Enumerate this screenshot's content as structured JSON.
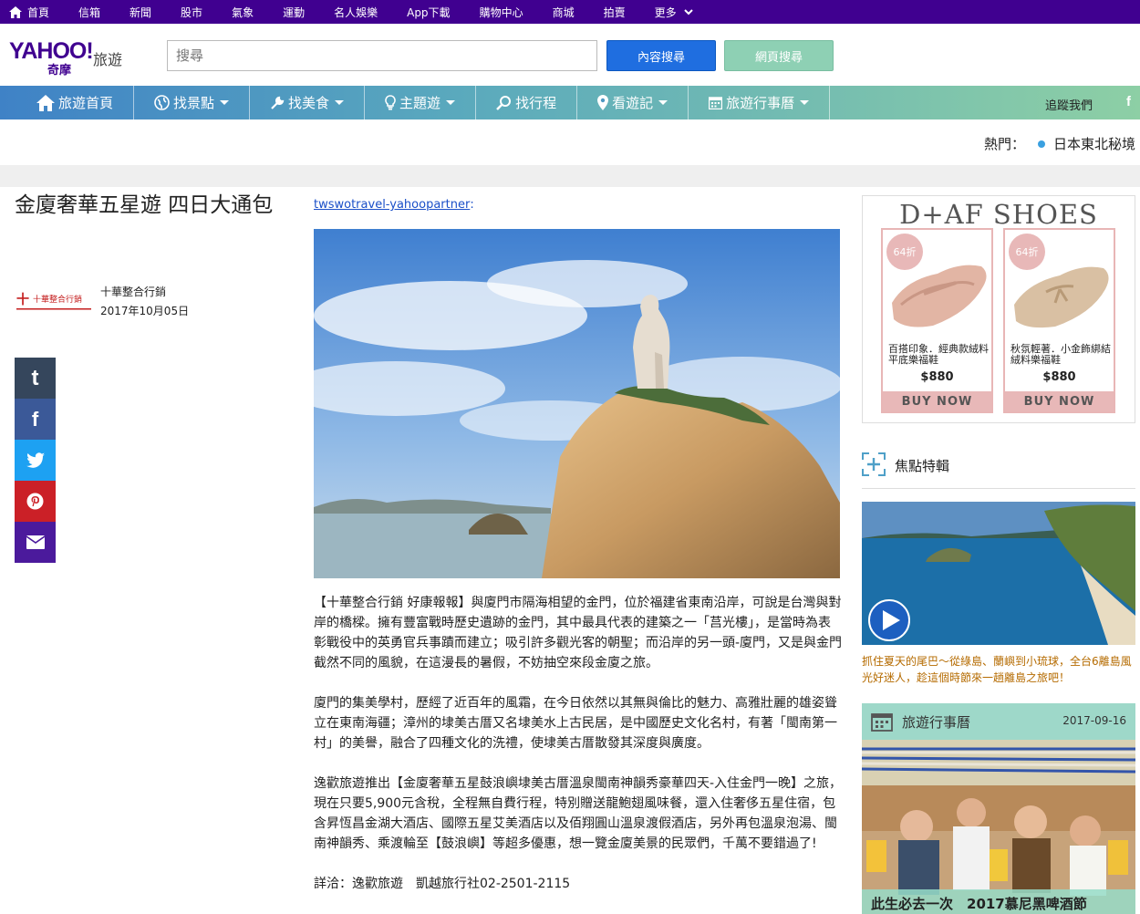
{
  "topbar": {
    "items": [
      "首頁",
      "信箱",
      "新聞",
      "股市",
      "氣象",
      "運動",
      "名人娛樂",
      "App下載",
      "購物中心",
      "商城",
      "拍賣",
      "更多"
    ]
  },
  "header": {
    "logo_text": "YAHOO!",
    "logo_sub": "奇摩",
    "section": "旅遊",
    "search_placeholder": "搜尋",
    "content_search": "內容搜尋",
    "web_search": "網頁搜尋"
  },
  "nav": {
    "items": [
      "旅遊首頁",
      "找景點",
      "找美食",
      "主題遊",
      "找行程",
      "看遊記",
      "旅遊行事曆"
    ],
    "follow": "追蹤我們",
    "fb": "f"
  },
  "hot": {
    "label": "熱門：",
    "link": "日本東北秘境"
  },
  "article": {
    "title": "金廈奢華五星遊 四日大通包",
    "author": "十華整合行銷",
    "date": "2017年10月05日",
    "logo_alt": "十華整合行銷",
    "source": "twswotravel-yahoopartner",
    "source_colon": ":",
    "paragraphs": [
      "【十華整合行銷 好康報報】與廈門市隔海相望的金門，位於福建省東南沿岸，可說是台灣與對岸的橋樑。擁有豐富戰時歷史遺跡的金門，其中最具代表的建築之一「莒光樓」，是當時為表彰戰役中的英勇官兵事蹟而建立；吸引許多觀光客的朝聖；而沿岸的另一頭-廈門，又是與金門截然不同的風貌，在這漫長的暑假，不妨抽空來段金廈之旅。",
      "廈門的集美學村，歷經了近百年的風霜，在今日依然以其無與倫比的魅力、高雅壯麗的雄姿聳立在東南海疆；漳州的埭美古厝又名埭美水上古民居，是中國歷史文化名村，有著「閩南第一村」的美譽，融合了四種文化的洗禮，使埭美古厝散發其深度與廣度。",
      "逸歡旅遊推出【金廈奢華五星鼓浪嶼埭美古厝溫泉閩南神韻秀豪華四天-入住金門一晚】之旅，現在只要5,900元含稅，全程無自費行程，特別贈送龍鮑翅風味餐，還入住奢侈五星住宿，包含昇恆昌金湖大酒店、國際五星艾美酒店以及佰翔圓山溫泉渡假酒店，另外再包溫泉泡湯、閩南神韻秀、乘渡輪至【鼓浪嶼】等超多優惠，想一覽金廈美景的民眾們，千萬不要錯過了!",
      "詳洽：逸歡旅遊　凱越旅行社02-2501-2115"
    ]
  },
  "ad": {
    "brand": "D+AF SHOES",
    "products": [
      {
        "discount": "64折",
        "name": "百搭印象．經典款絨料平底樂福鞋",
        "price": "$880",
        "cta": "BUY NOW"
      },
      {
        "discount": "64折",
        "name": "秋氛輕著．小金飾綁結絨料樂福鞋",
        "price": "$880",
        "cta": "BUY NOW"
      }
    ]
  },
  "focus": {
    "title": "焦點特輯",
    "caption": "抓住夏天的尾巴～從綠島、蘭嶼到小琉球，全台6離島風光好迷人，趁這個時節來一趟離島之旅吧！"
  },
  "calendar": {
    "title": "旅遊行事曆",
    "date": "2017-09-16",
    "caption": "此生必去一次　2017慕尼黑啤酒節"
  },
  "colors": {
    "topbar": "#400090",
    "nav_start": "#3f82c6",
    "nav_end": "#8dcfa5",
    "primary_button": "#1f6ee0",
    "secondary_button": "#8ed0b4",
    "ad_pink": "#e8b8b8",
    "caption_orange": "#b56b00"
  }
}
